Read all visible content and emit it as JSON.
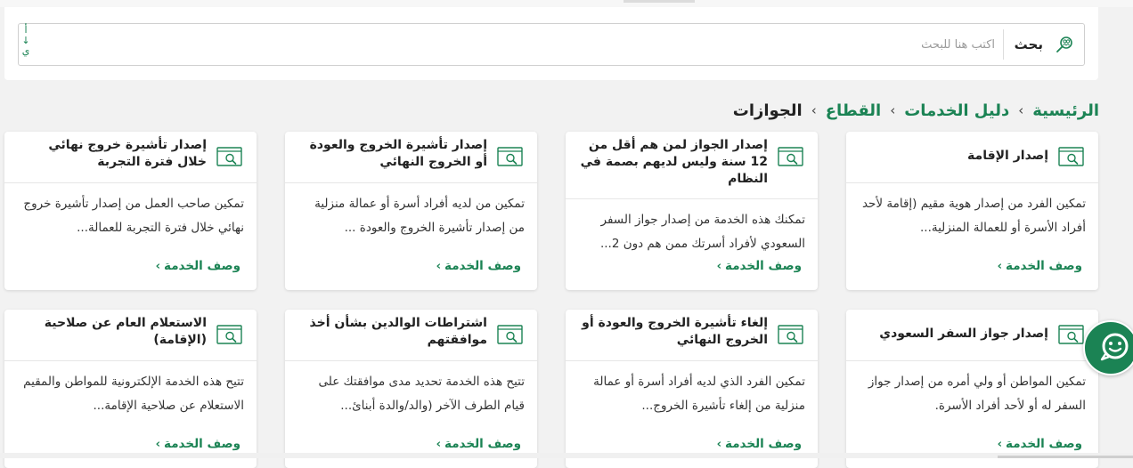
{
  "search": {
    "button_label": "بحث",
    "placeholder": "اكتب هنا للبحث",
    "value": "",
    "side_glyphs": [
      "أ",
      "↓",
      "ي"
    ]
  },
  "breadcrumb": {
    "items": [
      {
        "label": "الرئيسية"
      },
      {
        "label": "دليل الخدمات"
      },
      {
        "label": "القطاع"
      }
    ],
    "current": "الجوازات",
    "separator": "›"
  },
  "cards": [
    {
      "title": "إصدار الإقامة",
      "description": "تمكين الفرد من إصدار هوية مقيم (إقامة لأحد أفراد الأسرة أو للعمالة المنزلية...",
      "link": "وصف الخدمة"
    },
    {
      "title": "إصدار الجواز لمن هم أقل من 12 سنة وليس لديهم بصمة في النظام",
      "description": "تمكنك هذه الخدمة من إصدار جواز السفر السعودي لأفراد أسرتك ممن هم دون 2...",
      "link": "وصف الخدمة"
    },
    {
      "title": "إصدار تأشيرة الخروج والعودة أو الخروج النهائي",
      "description": "تمكين من لديه أفراد أسرة أو عمالة منزلية من إصدار تأشيرة الخروج والعودة ...",
      "link": "وصف الخدمة"
    },
    {
      "title": "إصدار تأشيرة خروج نهائي خلال فترة التجربة",
      "description": "تمكين صاحب العمل من إصدار تأشيرة خروج نهائي خلال فترة التجربة للعمالة...",
      "link": "وصف الخدمة"
    },
    {
      "title": "إصدار جواز السفر السعودي",
      "description": "تمكين المواطن أو ولي أمره من إصدار جواز السفر له أو لأحد أفراد الأسرة.",
      "link": "وصف الخدمة"
    },
    {
      "title": "إلغاء تأشيرة الخروج والعودة أو الخروج النهائي",
      "description": "تمكين الفرد الذي لديه أفراد أسرة أو عمالة منزلية من إلغاء تأشيرة الخروج...",
      "link": "وصف الخدمة"
    },
    {
      "title": "اشتراطات الوالدين بشأن أخذ موافقتهم",
      "description": "تتيح هذه الخدمة تحديد مدى موافقتك على قيام الطرف الآخر (والد/والدة أبنائ...",
      "link": "وصف الخدمة"
    },
    {
      "title": "الاستعلام العام عن صلاحية (الإقامة)",
      "description": "تتيح هذه الخدمة الإلكترونية للمواطن والمقيم الاستعلام عن صلاحية الإقامة...",
      "link": "وصف الخدمة"
    }
  ],
  "colors": {
    "accent": "#1b8354",
    "text": "#222222",
    "background": "#f2f2f2"
  },
  "icons": {
    "search": "search-people-icon",
    "service": "service-card-icon",
    "chat": "chatbot-icon",
    "chevron": "chevron-left-icon"
  }
}
